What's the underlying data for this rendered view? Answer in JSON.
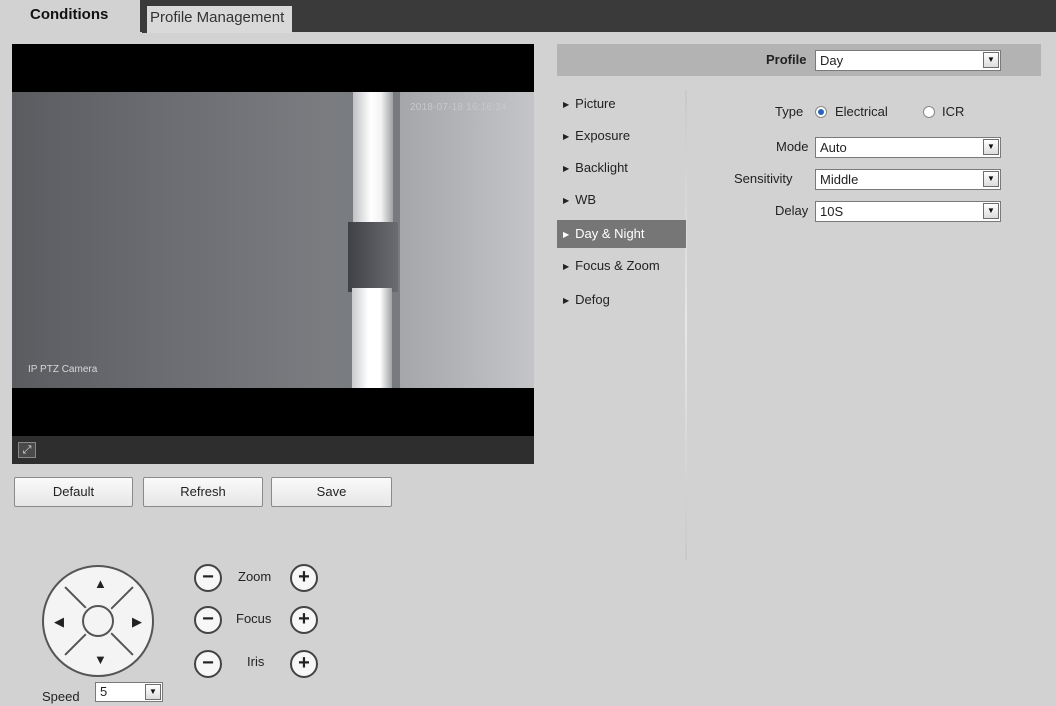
{
  "tabs": {
    "active": "Conditions",
    "inactive": "Profile Management"
  },
  "video": {
    "timestamp": "2018-07-18 16:16:34",
    "osd_camera_name": "IP PTZ Camera"
  },
  "buttons": {
    "default": "Default",
    "refresh": "Refresh",
    "save": "Save"
  },
  "ptz": {
    "zoom_label": "Zoom",
    "focus_label": "Focus",
    "iris_label": "Iris",
    "speed_label": "Speed",
    "speed_value": "5",
    "minus": "−",
    "plus": "+"
  },
  "profile": {
    "label": "Profile",
    "value": "Day"
  },
  "nav": {
    "items": [
      {
        "label": "Picture"
      },
      {
        "label": "Exposure"
      },
      {
        "label": "Backlight"
      },
      {
        "label": "WB"
      },
      {
        "label": "Day & Night"
      },
      {
        "label": "Focus & Zoom"
      },
      {
        "label": "Defog"
      }
    ],
    "active": "Day & Night"
  },
  "form": {
    "type_label": "Type",
    "type_options": [
      "Electrical",
      "ICR"
    ],
    "type_selected": "Electrical",
    "mode_label": "Mode",
    "mode_value": "Auto",
    "sensitivity_label": "Sensitivity",
    "sensitivity_value": "Middle",
    "delay_label": "Delay",
    "delay_value": "10S"
  },
  "colors": {
    "background": "#d2d2d2",
    "tabbar": "#3a3a3a",
    "nav_active": "#767676",
    "profile_bar": "#b3b3b3"
  },
  "icons": {
    "dropdown": "triangle-down",
    "fullscreen": "fullscreen-icon",
    "nav_bullet": "triangle-right"
  }
}
